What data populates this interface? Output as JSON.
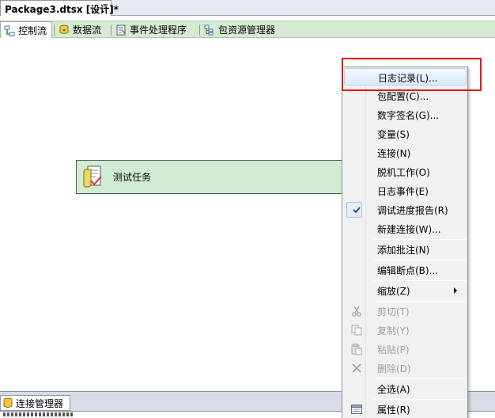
{
  "document_tab": {
    "title": "Package3.dtsx [设计]*"
  },
  "designer_tabs": [
    {
      "label": "控制流",
      "icon": "control-flow-icon"
    },
    {
      "label": "数据流",
      "icon": "data-flow-icon"
    },
    {
      "label": "事件处理程序",
      "icon": "event-handler-icon"
    },
    {
      "label": "包资源管理器",
      "icon": "package-explorer-icon"
    }
  ],
  "canvas": {
    "task": {
      "label": "测试任务",
      "icon": "script-task-icon"
    }
  },
  "bottom": {
    "connection_tab": "连接管理器"
  },
  "context_menu": {
    "items": [
      {
        "label": "日志记录(L)...",
        "highlighted": true
      },
      {
        "label": "包配置(C)..."
      },
      {
        "label": "数字签名(G)..."
      },
      {
        "label": "变量(S)"
      },
      {
        "label": "连接(N)"
      },
      {
        "label": "脱机工作(O)"
      },
      {
        "label": "日志事件(E)"
      },
      {
        "label": "调试进度报告(R)",
        "checked": true
      },
      {
        "label": "新建连接(W)..."
      },
      {
        "label": "添加批注(N)"
      },
      {
        "label": "编辑断点(B)..."
      },
      {
        "label": "缩放(Z)",
        "submenu": true
      },
      {
        "label": "剪切(T)",
        "disabled": true,
        "icon": "cut-icon"
      },
      {
        "label": "复制(Y)",
        "disabled": true,
        "icon": "copy-icon"
      },
      {
        "label": "粘贴(P)",
        "disabled": true,
        "icon": "paste-icon"
      },
      {
        "label": "删除(D)",
        "disabled": true,
        "icon": "delete-icon"
      },
      {
        "label": "全选(A)"
      },
      {
        "label": "属性(R)",
        "icon": "properties-icon"
      }
    ]
  },
  "colors": {
    "designer_tab_bg": "#d6ecd2",
    "task_fill": "#d2ebd3",
    "menu_highlight_border": "#aecff7",
    "callout_red": "#e01b1b"
  }
}
